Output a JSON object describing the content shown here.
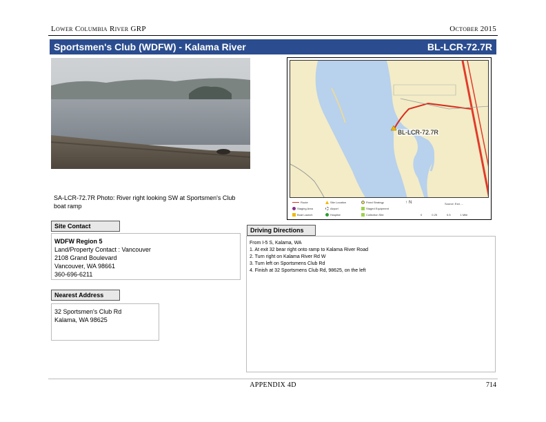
{
  "header": {
    "left": "Lower Columbia River GRP",
    "right": "October 2015"
  },
  "title": {
    "site_name": "Sportsmen's Club (WDFW) - Kalama River",
    "site_code": "BL-LCR-72.7R"
  },
  "photo": {
    "caption": "SA-LCR-72.7R Photo: River right looking SW at Sportsmen's Club boat ramp"
  },
  "map": {
    "site_label": "BL-LCR-72.7R",
    "colors": {
      "water": "#b8d1ec",
      "land": "#f3ecc6",
      "road": "#e33a2a",
      "route": "#d92d20"
    },
    "legend": {
      "route": "Route",
      "staging_area": "Staging Area",
      "boat_launch": "Boat Launch",
      "site": "Site Location",
      "airport": "Airport",
      "hospital": "Hospital",
      "fixed_strategy": "Fixed Strategy",
      "staged_eq": "Staged Equipment",
      "collection": "Collection Site",
      "north": "N",
      "source": "Source: Esri, ...",
      "scale": [
        "0",
        "0.25",
        "0.5",
        "1 Mile"
      ]
    }
  },
  "site_contact": {
    "label": "Site Contact",
    "org": "WDFW Region 5",
    "contact": "Land/Property Contact : Vancouver",
    "street": "2108 Grand Boulevard",
    "city": "Vancouver, WA 98661",
    "phone": "360-696-6211"
  },
  "nearest_address": {
    "label": "Nearest Address",
    "line1": "32 Sportsmen's Club Rd",
    "line2": "Kalama, WA  98625"
  },
  "driving_directions": {
    "label": "Driving Directions",
    "lines": [
      "From I-5 S, Kalama, WA",
      "1. At exit 32 bear right onto ramp to Kalama River Road",
      "2. Turn right on Kalama River Rd W",
      "3. Turn left on Sportsmens Club Rd",
      "4. Finish at 32 Sportsmens Club Rd, 98625, on the left"
    ]
  },
  "footer": {
    "center": "APPENDIX 4D",
    "page": "714"
  }
}
